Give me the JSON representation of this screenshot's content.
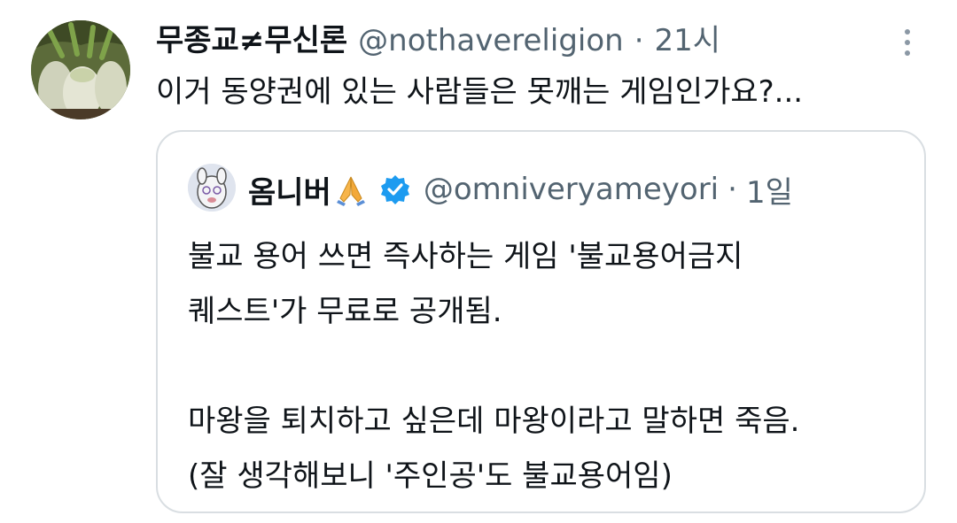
{
  "tweet": {
    "author_name": "무종교≠무신론",
    "handle": "@nothavereligion",
    "separator": "·",
    "time": "21시",
    "text": "이거 동양권에 있는 사람들은 못깨는 게임인가요?...",
    "avatar_icon": "daikon-radish-photo-icon",
    "menu_icon": "more-options-icon"
  },
  "quote": {
    "author_name": "옴니버",
    "emoji_icon": "folded-hands-emoji-icon",
    "verified_icon": "verified-badge-icon",
    "handle": "@omniveryameyori",
    "separator": "·",
    "time": "1일",
    "lines": [
      "불교 용어 쓰면 즉사하는 게임 '불교용어금지",
      "퀘스트'가 무료로 공개됨.",
      "마왕을 퇴치하고 싶은데 마왕이라고 말하면 죽음.",
      "(잘 생각해보니 '주인공'도 불교용어임)"
    ]
  },
  "colors": {
    "text": "#0f1419",
    "secondary": "#536471",
    "border": "#d9dee2",
    "verified": "#1d9bf0"
  }
}
